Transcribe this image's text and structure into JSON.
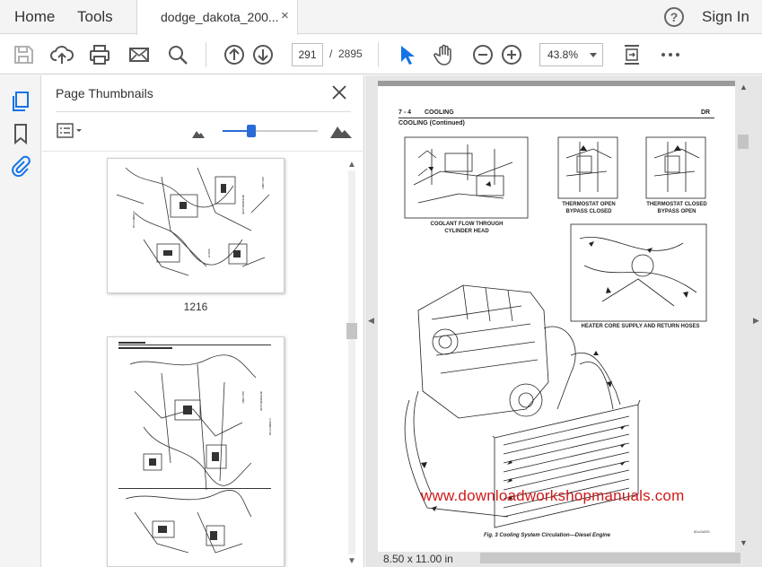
{
  "menubar": {
    "home_label": "Home",
    "tools_label": "Tools",
    "doc_tab_title": "dodge_dakota_200...",
    "doc_tab_close": "×",
    "help_glyph": "?",
    "signin_label": "Sign In"
  },
  "toolbar": {
    "icons": [
      "save-icon",
      "upload-cloud-icon",
      "print-icon",
      "email-icon",
      "search-icon",
      "previous-page-icon",
      "next-page-icon",
      "select-cursor-icon",
      "hand-tool-icon",
      "zoom-out-icon",
      "zoom-in-icon",
      "fit-page-icon",
      "more-icon"
    ],
    "current_page": "291",
    "page_separator": "/",
    "total_pages": "2895",
    "zoom_value": "43.8%"
  },
  "left_strip": {
    "icons": [
      "page-thumbnails-icon",
      "bookmarks-icon",
      "attachments-icon"
    ],
    "accent": "#1473e6"
  },
  "thumbnails_panel": {
    "title": "Page Thumbnails",
    "thumbnail_size_level": 0.3,
    "thumbnails": [
      {
        "label": "1216"
      }
    ]
  },
  "document": {
    "header_number": "7 - 4",
    "header_section": "COOLING",
    "header_code": "DR",
    "subheader": "COOLING (Continued)",
    "captions": {
      "coolant_flow": "COOLANT FLOW THROUGH\nCYLINDER HEAD",
      "thermostat_open": "THERMOSTAT OPEN\nBYPASS CLOSED",
      "thermostat_closed": "THERMOSTAT CLOSED\nBYPASS OPEN",
      "heater_core": "HEATER CORE SUPPLY AND RETURN HOSES"
    },
    "watermark": "www.downloadworkshopmanuals.com",
    "watermark_color": "#d01a1a",
    "figure_caption": "Fig. 3 Cooling System Circulation—Diesel Engine",
    "figure_code": "80c2a005",
    "page_size": "8.50 x 11.00 in"
  }
}
